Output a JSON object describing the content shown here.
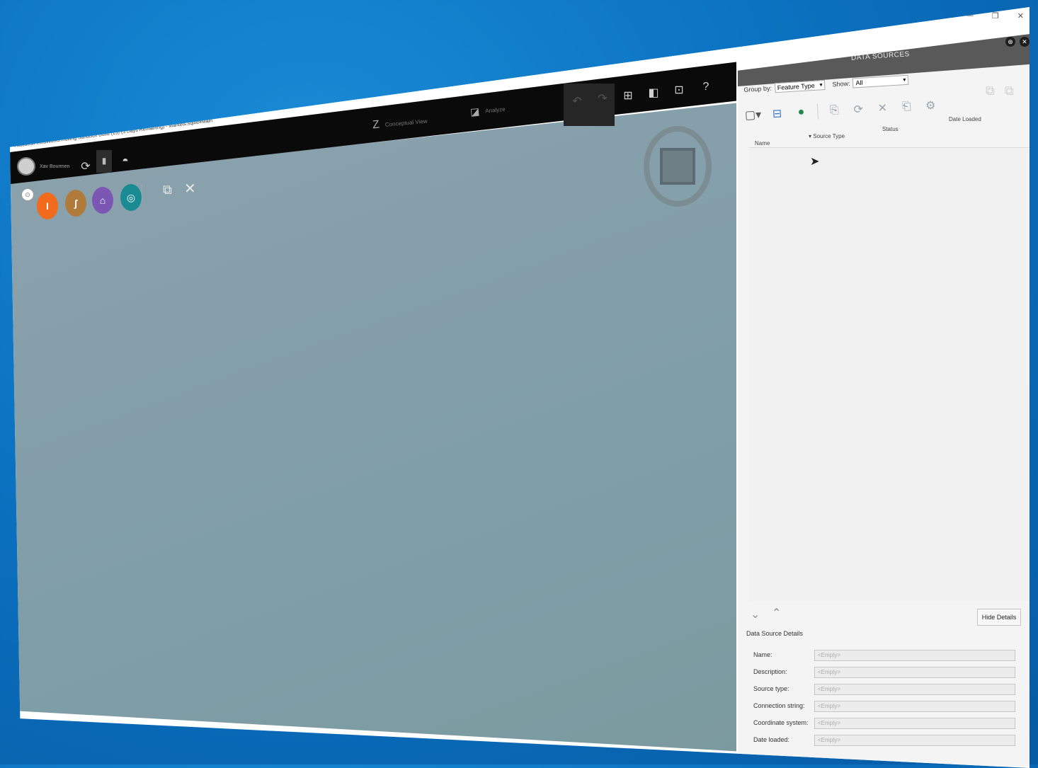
{
  "window": {
    "title": "Autodesk InfraWorks Rolling Sandbox Build (15) (3 Days Remaining) - Markets.sqlite#Main",
    "controls": [
      "—",
      "❐",
      "✕"
    ]
  },
  "topbar": {
    "user_label": "Xav Bourmen",
    "center_tools": [
      {
        "label": "Conceptual View",
        "icon": "conceptual-design-icon"
      },
      {
        "label": "Analyze",
        "icon": "analyze-icon"
      }
    ],
    "right_tools": [
      "undo-icon",
      "redo-icon",
      "insert-icon",
      "panel-icon",
      "grid-icon",
      "help-icon"
    ]
  },
  "toolrow": {
    "items": [
      {
        "name": "create-manage",
        "color": "#ffffff",
        "glyph": "◯"
      },
      {
        "name": "design-roads",
        "color": "#f26a1b",
        "glyph": "I"
      },
      {
        "name": "design-bridges",
        "color": "#b07a3a",
        "glyph": "ʃ"
      },
      {
        "name": "design-structures",
        "color": "#7b57b3",
        "glyph": "⌂"
      },
      {
        "name": "design-drainage",
        "color": "#1a8b93",
        "glyph": "◎"
      }
    ],
    "extra": [
      "presentation-icon",
      "tools-icon"
    ]
  },
  "panel": {
    "title": "DATA SOURCES",
    "group_by_label": "Group by:",
    "group_by_value": "Feature Type",
    "show_label": "Show:",
    "show_value": "All",
    "columns": [
      "Name",
      "Source Type",
      "Status",
      "Date Loaded"
    ],
    "hide_details_label": "Hide Details",
    "details_title": "Data Source Details",
    "detail_rows": [
      {
        "label": "Name:",
        "value": "<Empty>"
      },
      {
        "label": "Description:",
        "value": "<Empty>"
      },
      {
        "label": "Source type:",
        "value": "<Empty>"
      },
      {
        "label": "Connection string:",
        "value": "<Empty>"
      },
      {
        "label": "Coordinate system:",
        "value": "<Empty>"
      },
      {
        "label": "Date loaded:",
        "value": "<Empty>"
      }
    ]
  }
}
